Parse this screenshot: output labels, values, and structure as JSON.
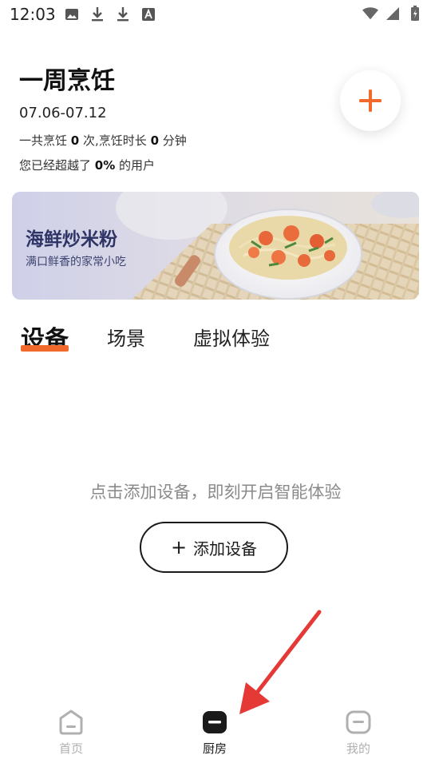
{
  "status_bar": {
    "time": "12:03",
    "left_icons": [
      "image-icon",
      "download-icon",
      "download-icon",
      "font-icon"
    ],
    "right_icons": [
      "wifi-icon",
      "signal-icon",
      "battery-icon"
    ]
  },
  "header": {
    "title": "一周烹饪",
    "date_range": "07.06-07.12",
    "stats": {
      "prefix": "一共烹饪",
      "count": "0",
      "middle": "次,烹饪时长",
      "duration": "0",
      "suffix": "分钟"
    },
    "rank": {
      "prefix": "您已经超越了",
      "percent": "0%",
      "suffix": "的用户"
    },
    "add_icon": "plus-icon"
  },
  "banner": {
    "title": "海鲜炒米粉",
    "subtitle": "满口鲜香的家常小吃"
  },
  "tabs": [
    {
      "label": "设备",
      "active": true
    },
    {
      "label": "场景",
      "active": false
    },
    {
      "label": "虚拟体验",
      "active": false
    }
  ],
  "empty_state": {
    "hint": "点击添加设备，即刻开启智能体验",
    "button_label": "添加设备"
  },
  "bottom_nav": [
    {
      "label": "首页",
      "icon": "home-icon",
      "active": false
    },
    {
      "label": "厨房",
      "icon": "kitchen-icon",
      "active": true
    },
    {
      "label": "我的",
      "icon": "profile-icon",
      "active": false
    }
  ],
  "colors": {
    "accent": "#f26a2b",
    "banner_title": "#2e3566",
    "nav_inactive": "#b0b0b0",
    "annotation_arrow": "#e53935"
  }
}
